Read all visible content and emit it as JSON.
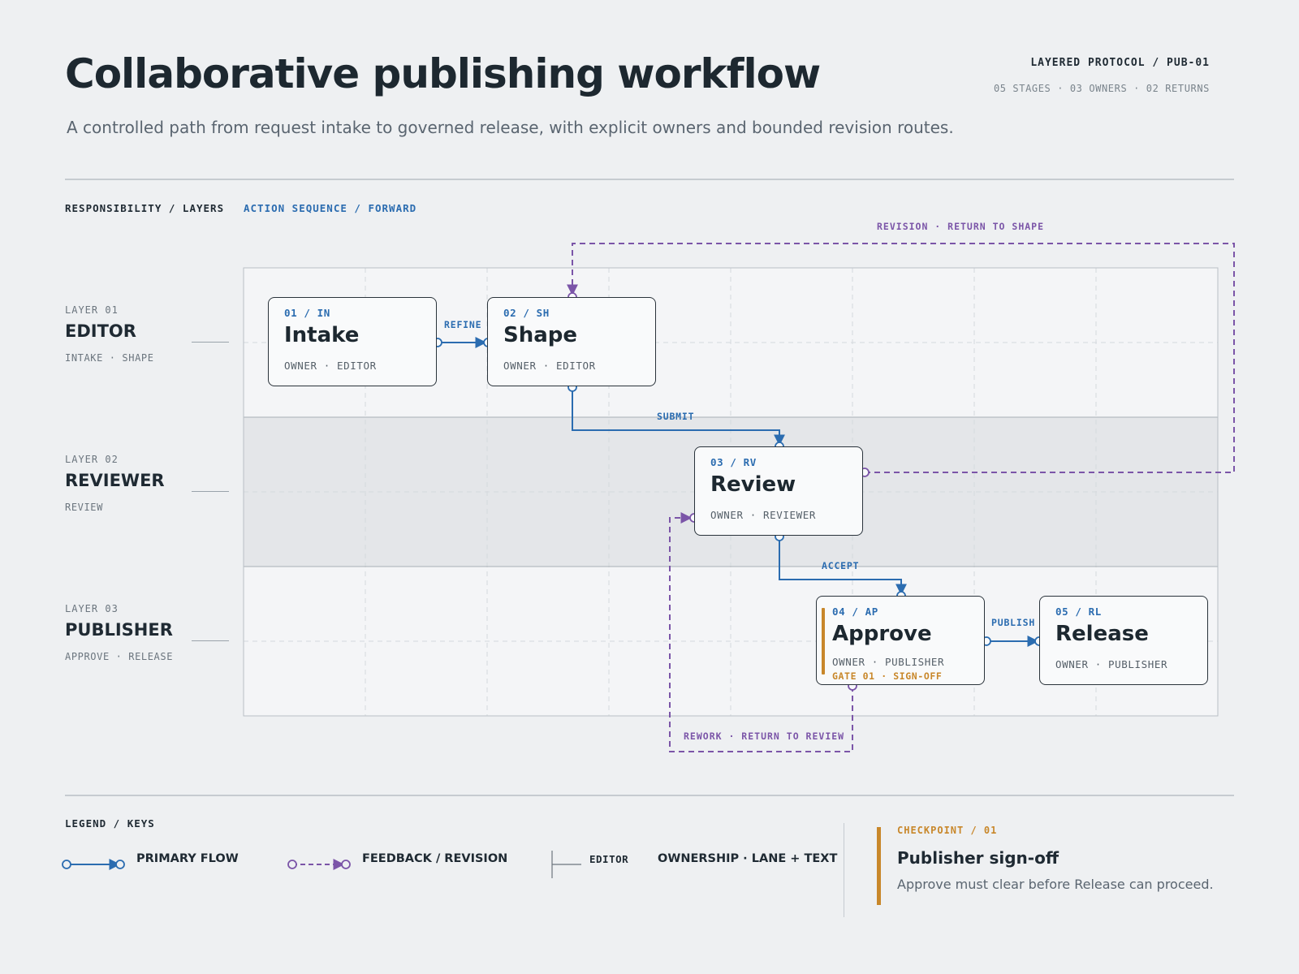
{
  "header": {
    "title": "Collaborative publishing workflow",
    "subtitle": "A controlled path from request intake to governed release, with explicit owners and bounded revision routes.",
    "protocol": "LAYERED PROTOCOL / PUB-01",
    "stats": "05 STAGES · 03 OWNERS · 02 RETURNS"
  },
  "section_labels": {
    "responsibility": "RESPONSIBILITY / LAYERS",
    "action": "ACTION SEQUENCE / FORWARD"
  },
  "layers": [
    {
      "code": "LAYER 01",
      "name": "EDITOR",
      "stages": "INTAKE · SHAPE"
    },
    {
      "code": "LAYER 02",
      "name": "REVIEWER",
      "stages": "REVIEW"
    },
    {
      "code": "LAYER 03",
      "name": "PUBLISHER",
      "stages": "APPROVE · RELEASE"
    }
  ],
  "nodes": [
    {
      "code": "01 / IN",
      "name": "Intake",
      "owner": "OWNER · EDITOR"
    },
    {
      "code": "02 / SH",
      "name": "Shape",
      "owner": "OWNER · EDITOR"
    },
    {
      "code": "03 / RV",
      "name": "Review",
      "owner": "OWNER · REVIEWER"
    },
    {
      "code": "04 / AP",
      "name": "Approve",
      "owner": "OWNER · PUBLISHER",
      "gate": "GATE 01 · SIGN-OFF"
    },
    {
      "code": "05 / RL",
      "name": "Release",
      "owner": "OWNER · PUBLISHER"
    }
  ],
  "edges": {
    "refine": "REFINE",
    "submit": "SUBMIT",
    "accept": "ACCEPT",
    "publish": "PUBLISH",
    "revision": "REVISION · RETURN TO SHAPE",
    "rework": "REWORK · RETURN TO REVIEW"
  },
  "legend": {
    "label": "LEGEND / KEYS",
    "primary": "PRIMARY FLOW",
    "feedback": "FEEDBACK / REVISION",
    "editor": "EDITOR",
    "ownership": "OWNERSHIP · LANE + TEXT"
  },
  "checkpoint": {
    "code": "CHECKPOINT / 01",
    "title": "Publisher sign-off",
    "description": "Approve must clear before Release can proceed."
  },
  "colors": {
    "primary": "#2b6cb0",
    "revision": "#7b55a8",
    "gate": "#c8872a"
  }
}
